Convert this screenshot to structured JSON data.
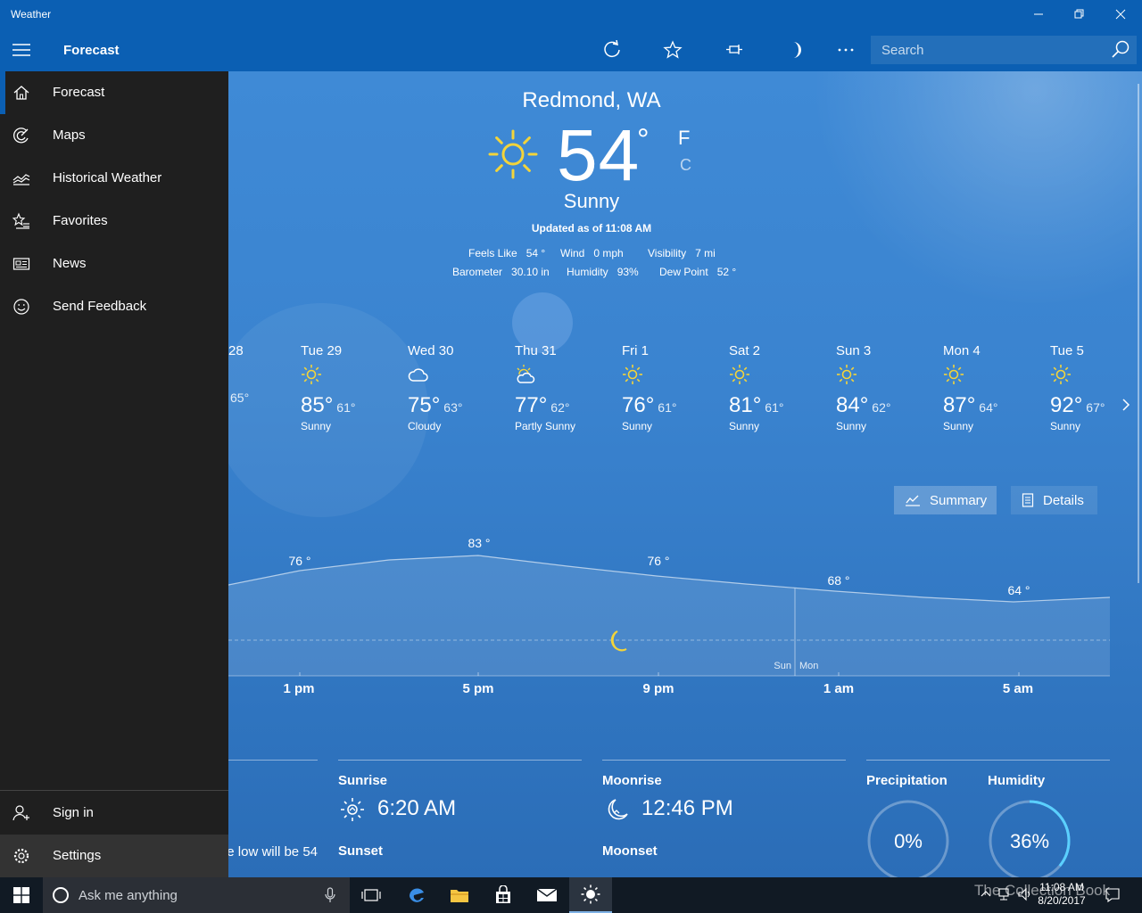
{
  "window": {
    "title": "Weather"
  },
  "appbar": {
    "section_title": "Forecast"
  },
  "search": {
    "placeholder": "Search"
  },
  "nav": {
    "items": [
      {
        "label": "Forecast"
      },
      {
        "label": "Maps"
      },
      {
        "label": "Historical Weather"
      },
      {
        "label": "Favorites"
      },
      {
        "label": "News"
      },
      {
        "label": "Send Feedback"
      }
    ],
    "footer": [
      {
        "label": "Sign in"
      },
      {
        "label": "Settings"
      }
    ]
  },
  "current": {
    "location": "Redmond, WA",
    "temperature": "54",
    "degree": "°",
    "unit_f": "F",
    "unit_c": "C",
    "condition": "Sunny",
    "updated": "Updated as of 11:08 AM",
    "details": [
      {
        "label": "Feels Like",
        "value": "54 °"
      },
      {
        "label": "Wind",
        "value": "0 mph"
      },
      {
        "label": "Visibility",
        "value": "7 mi"
      },
      {
        "label": "Barometer",
        "value": "30.10 in"
      },
      {
        "label": "Humidity",
        "value": "93%"
      },
      {
        "label": "Dew Point",
        "value": "52 °"
      }
    ]
  },
  "daily": [
    {
      "day": "28",
      "hi": "",
      "lo": "65°",
      "condition": "",
      "icon": "sun-icon"
    },
    {
      "day": "Tue 29",
      "hi": "85°",
      "lo": "61°",
      "condition": "Sunny",
      "icon": "sun-icon"
    },
    {
      "day": "Wed 30",
      "hi": "75°",
      "lo": "63°",
      "condition": "Cloudy",
      "icon": "cloud-icon"
    },
    {
      "day": "Thu 31",
      "hi": "77°",
      "lo": "62°",
      "condition": "Partly Sunny",
      "icon": "partly-sunny-icon"
    },
    {
      "day": "Fri 1",
      "hi": "76°",
      "lo": "61°",
      "condition": "Sunny",
      "icon": "sun-icon"
    },
    {
      "day": "Sat 2",
      "hi": "81°",
      "lo": "61°",
      "condition": "Sunny",
      "icon": "sun-icon"
    },
    {
      "day": "Sun 3",
      "hi": "84°",
      "lo": "62°",
      "condition": "Sunny",
      "icon": "sun-icon"
    },
    {
      "day": "Mon 4",
      "hi": "87°",
      "lo": "64°",
      "condition": "Sunny",
      "icon": "sun-icon"
    },
    {
      "day": "Tue 5",
      "hi": "92°",
      "lo": "67°",
      "condition": "Sunny",
      "icon": "sun-icon"
    }
  ],
  "views": {
    "summary": "Summary",
    "details": "Details"
  },
  "hourly": {
    "temp_labels": [
      "76 °",
      "83 °",
      "76 °",
      "68 °",
      "64 °"
    ],
    "time_labels": [
      "1 pm",
      "5 pm",
      "9 pm",
      "1 am",
      "5 am"
    ],
    "day_split": [
      "Sun",
      "Mon"
    ]
  },
  "bottom": {
    "partial_text": "e low will be 54.",
    "sunrise_label": "Sunrise",
    "sunrise_value": "6:20 AM",
    "sunset_label": "Sunset",
    "moonrise_label": "Moonrise",
    "moonrise_value": "12:46 PM",
    "moonset_label": "Moonset",
    "precip_label": "Precipitation",
    "precip_value": "0%",
    "precip_fraction": 0,
    "humidity_label": "Humidity",
    "humidity_value": "36%",
    "humidity_fraction": 0.36
  },
  "taskbar": {
    "search_placeholder": "Ask me anything",
    "time": "11:08 AM",
    "date": "8/20/2017",
    "watermark": "The Collection Book"
  }
}
